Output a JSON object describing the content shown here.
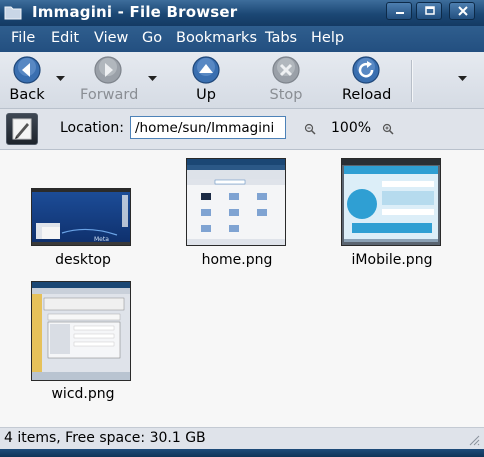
{
  "window": {
    "title": "Immagini - File Browser",
    "controls": [
      "minimize",
      "maximize",
      "close"
    ]
  },
  "menubar": {
    "items": [
      {
        "label": "File"
      },
      {
        "label": "Edit"
      },
      {
        "label": "View"
      },
      {
        "label": "Go"
      },
      {
        "label": "Bookmarks"
      },
      {
        "label": "Tabs"
      },
      {
        "label": "Help"
      }
    ]
  },
  "toolbar": {
    "back": "Back",
    "forward": "Forward",
    "up": "Up",
    "stop": "Stop",
    "reload": "Reload"
  },
  "locationbar": {
    "label": "Location:",
    "value": "/home/sun/Immagini",
    "zoom": "100%"
  },
  "files": [
    {
      "name": "desktop"
    },
    {
      "name": "home.png"
    },
    {
      "name": "iMobile.png"
    },
    {
      "name": "wicd.png"
    }
  ],
  "status": {
    "text": "4 items, Free space: 30.1 GB"
  },
  "colors": {
    "title_bar": "#1b4774",
    "menu_bar": "#2a578a",
    "toolbar_icon": "#3a6fb0",
    "selection_border": "#4d82b8"
  }
}
